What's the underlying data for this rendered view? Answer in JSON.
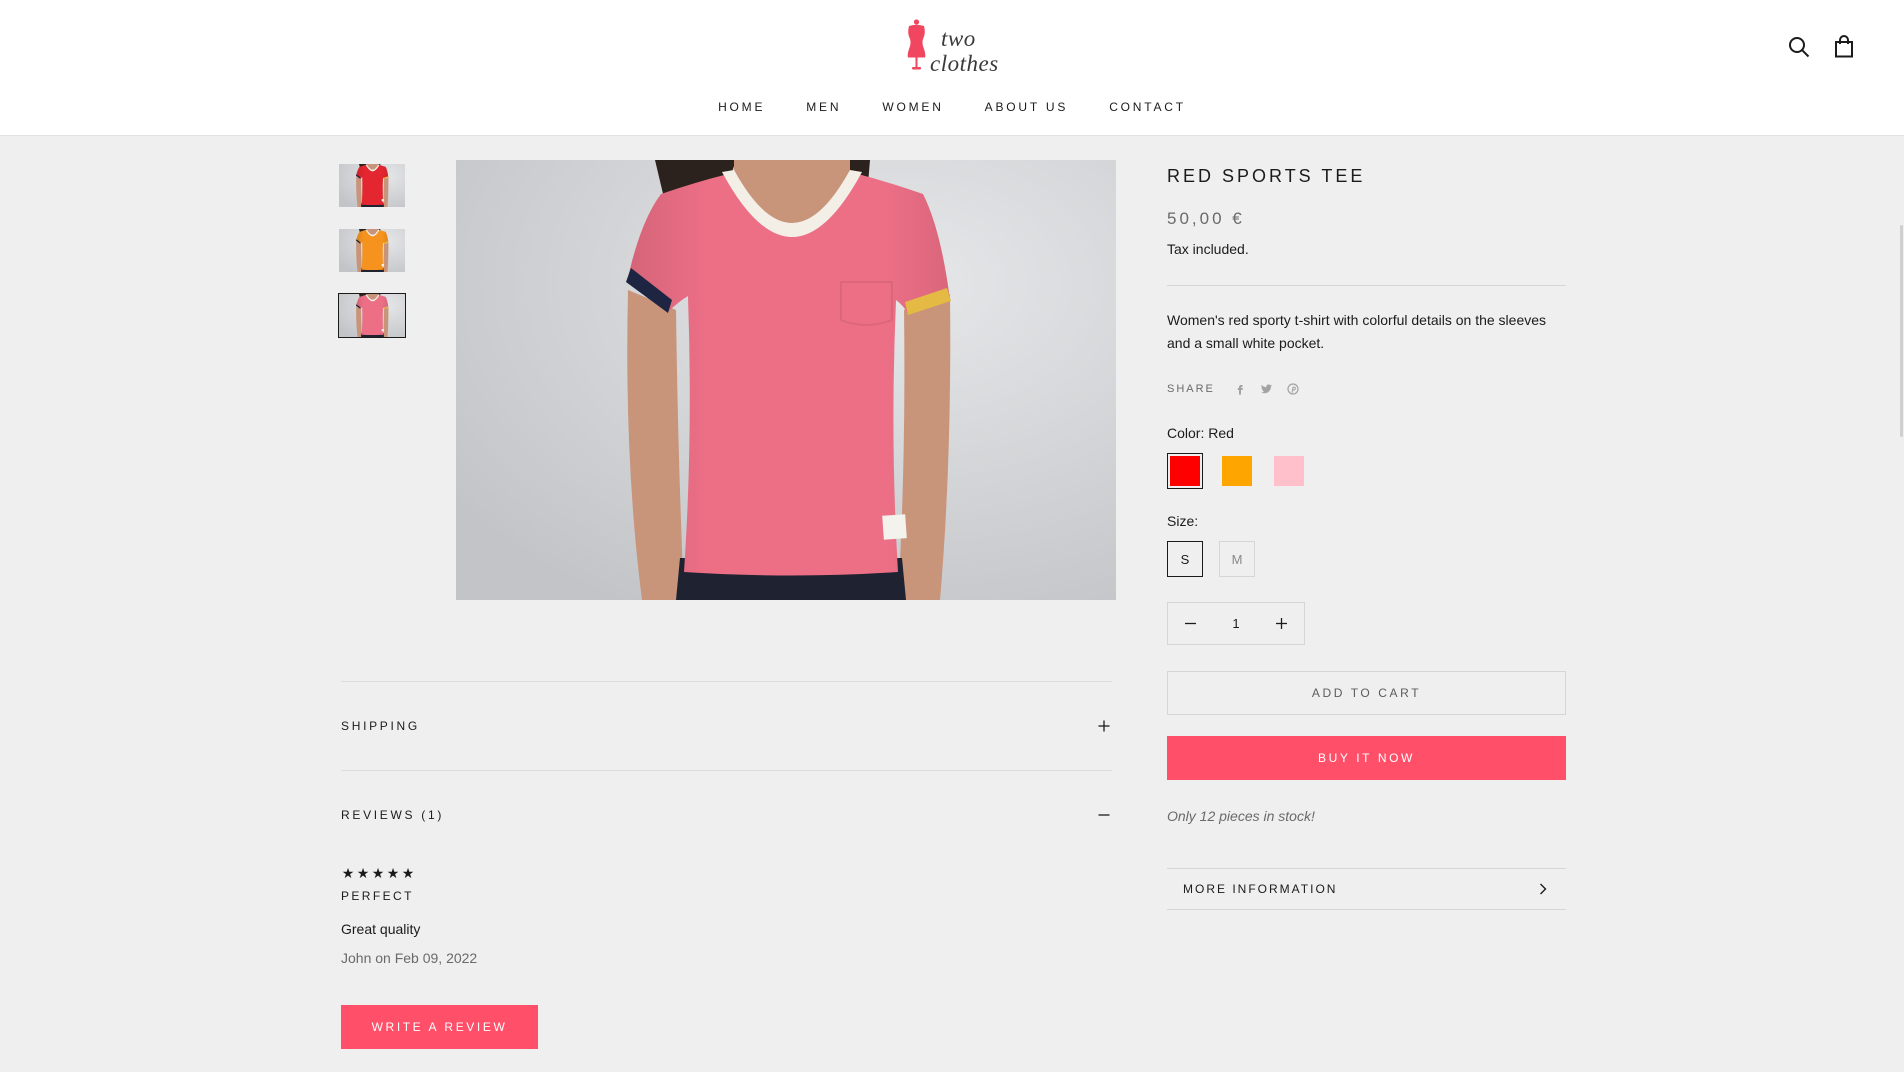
{
  "brand": {
    "logo_icon": "mannequin-icon",
    "line1": "two",
    "line2": "clothes"
  },
  "nav": [
    {
      "label": "HOME"
    },
    {
      "label": "MEN"
    },
    {
      "label": "WOMEN"
    },
    {
      "label": "ABOUT US"
    },
    {
      "label": "CONTACT"
    }
  ],
  "header_icons": {
    "search": "search-icon",
    "cart": "bag-icon"
  },
  "gallery": {
    "selected_index": 2,
    "thumbnails": [
      {
        "shirt_color": "#e3262f"
      },
      {
        "shirt_color": "#f5931e"
      },
      {
        "shirt_color": "#ec6f86"
      }
    ]
  },
  "product": {
    "title": "RED SPORTS TEE",
    "price": "50,00 €",
    "tax_note": "Tax included.",
    "description": "Women's red sporty t-shirt with colorful details on the sleeves and a small white pocket.",
    "share": {
      "label": "SHARE",
      "icons": [
        "facebook-icon",
        "twitter-icon",
        "pinterest-icon"
      ]
    },
    "color_label": "Color:",
    "color_value": "Red",
    "colors": [
      {
        "hex": "#ff0000",
        "selected": true
      },
      {
        "hex": "#ffa500",
        "selected": false
      },
      {
        "hex": "#ffc0cb",
        "selected": false
      }
    ],
    "size_label": "Size:",
    "sizes": [
      {
        "label": "S",
        "selected": true
      },
      {
        "label": "M",
        "selected": false
      }
    ],
    "quantity": "1",
    "add_to_cart_label": "ADD TO CART",
    "buy_now_label": "BUY IT NOW",
    "stock_note": "Only 12 pieces in stock!",
    "more_info_label": "MORE INFORMATION"
  },
  "details": {
    "shipping_label": "SHIPPING",
    "shipping_icon": "plus-icon",
    "reviews_label": "REVIEWS (1)",
    "reviews_icon": "minus-icon"
  },
  "review": {
    "rating": 5,
    "rating_max": 5,
    "title": "PERFECT",
    "body": "Great quality",
    "byline": "John on Feb 09, 2022"
  },
  "write_review_label": "WRITE A REVIEW",
  "theme": {
    "accent": "#ff4f69",
    "logo": "#f0465f",
    "text": "#1c1b1b",
    "muted": "#6a6a6a",
    "page_bg": "#efefef"
  }
}
